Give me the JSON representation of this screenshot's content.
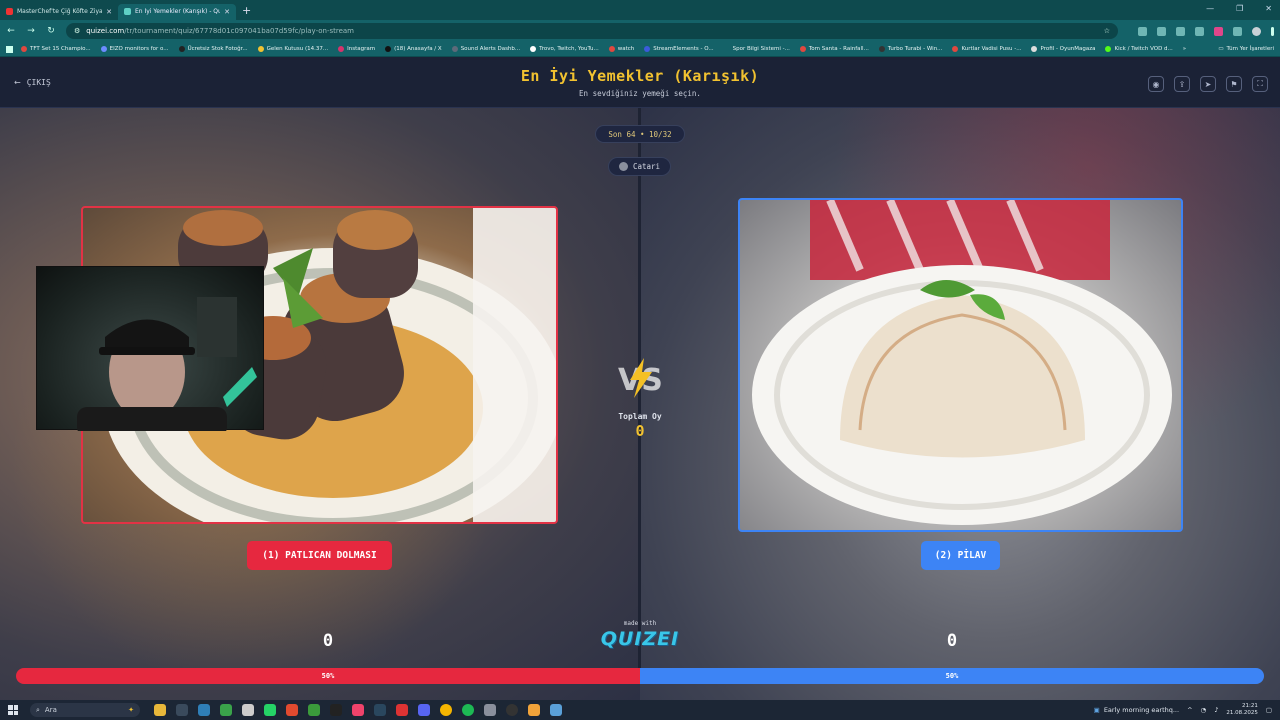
{
  "browser": {
    "tabs": [
      {
        "title": "MasterChef'te Çiğ Köfte Ziyafeti",
        "active": false
      },
      {
        "title": "En İyi Yemekler (Karışık) - Quizei",
        "active": true
      }
    ],
    "url_host": "quizei.com",
    "url_path": "/tr/tournament/quiz/67778d01c097041ba07d59fc/play-on-stream",
    "bookmarks": [
      "TFT Set 15 Champio...",
      "EIZO monitors for o...",
      "Ücretsiz Stok Fotoğr...",
      "Gelen Kutusu (14.37...",
      "Instagram",
      "(18) Anasayfa / X",
      "Sound Alerts Dashb...",
      "Trovo, Twitch, YouTu...",
      "watch",
      "StreamElements - O...",
      "Spor Bilgi Sistemi -...",
      "Tom Santa - Rainfall...",
      "Turbo Turabi - Win...",
      "Kurtlar Vadisi Pusu -...",
      "Profil - OyunMagaza",
      "Kick / Twitch VOD d..."
    ],
    "bookmarks_all": "Tüm Yer İşaretleri"
  },
  "header": {
    "exit_label": "ÇIKIŞ",
    "title": "En İyi Yemekler (Karışık)",
    "subtitle": "En sevdiğiniz yemeği seçin."
  },
  "round": {
    "label": "Son 64 • 10/32",
    "host_name": "Catari"
  },
  "left": {
    "choice_label": "(1) PATLICAN DOLMASI",
    "votes": "0",
    "percent": "50%",
    "share": 0.5
  },
  "right": {
    "choice_label": "(2) PİLAV",
    "votes": "0",
    "percent": "50%",
    "share": 0.5
  },
  "center": {
    "vs_text": "VS",
    "total_label": "Toplam Oy",
    "total_value": "0",
    "made_with": "made with",
    "brand": "QUIZEI"
  },
  "taskbar": {
    "search_placeholder": "Ara",
    "weather_text": "Early morning earthq...",
    "time": "21:21",
    "date": "21.08.2025"
  },
  "colors": {
    "left_accent": "#e6283f",
    "right_accent": "#3d84f5",
    "title_gold": "#f2c230"
  }
}
